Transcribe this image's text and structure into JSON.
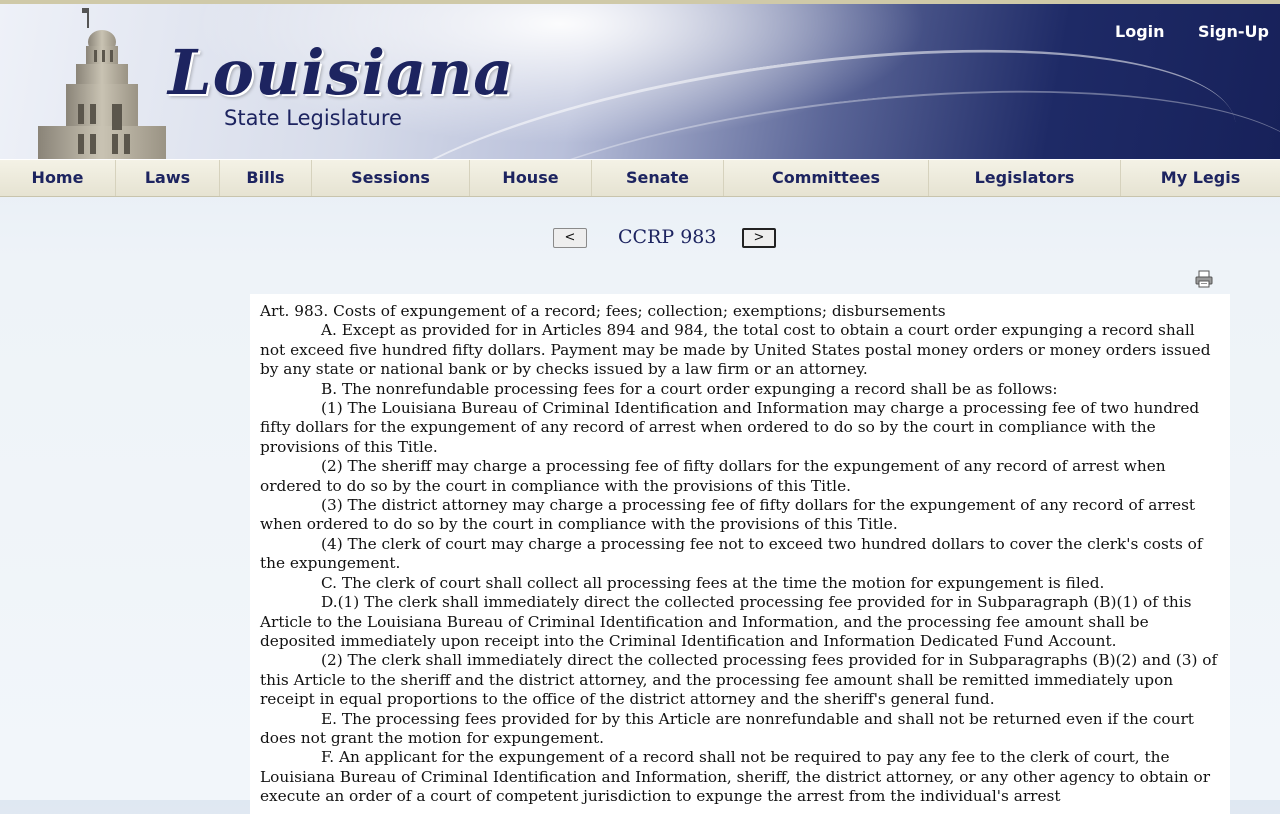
{
  "header": {
    "logo_script": "Louisiana",
    "logo_sub": "State Legislature",
    "login": "Login",
    "signup": "Sign-Up"
  },
  "nav": {
    "items": [
      "Home",
      "Laws",
      "Bills",
      "Sessions",
      "House",
      "Senate",
      "Committees",
      "Legislators",
      "My Legis"
    ]
  },
  "doc_nav": {
    "prev": "<",
    "title": "CCRP 983",
    "next": ">"
  },
  "icons": {
    "print": "print-icon"
  },
  "content": {
    "paragraphs": [
      "Art. 983. Costs of expungement of a record; fees; collection; exemptions; disbursements",
      "A. Except as provided for in Articles 894 and 984, the total cost to obtain a court order expunging a record shall not exceed five hundred fifty dollars. Payment may be made by United States postal money orders or money orders issued by any state or national bank or by checks issued by a law firm or an attorney.",
      "B. The nonrefundable processing fees for a court order expunging a record shall be as follows:",
      "(1) The Louisiana Bureau of Criminal Identification and Information may charge a processing fee of two hundred fifty dollars for the expungement of any record of arrest when ordered to do so by the court in compliance with the provisions of this Title.",
      "(2) The sheriff may charge a processing fee of fifty dollars for the expungement of any record of arrest when ordered to do so by the court in compliance with the provisions of this Title.",
      "(3) The district attorney may charge a processing fee of fifty dollars for the expungement of any record of arrest when ordered to do so by the court in compliance with the provisions of this Title.",
      "(4) The clerk of court may charge a processing fee not to exceed two hundred dollars to cover the clerk's costs of the expungement.",
      "C. The clerk of court shall collect all processing fees at the time the motion for expungement is filed.",
      "D.(1) The clerk shall immediately direct the collected processing fee provided for in Subparagraph (B)(1) of this Article to the Louisiana Bureau of Criminal Identification and Information, and the processing fee amount shall be deposited immediately upon receipt into the Criminal Identification and Information Dedicated Fund Account.",
      "(2) The clerk shall immediately direct the collected processing fees provided for in Subparagraphs (B)(2) and (3) of this Article to the sheriff and the district attorney, and the processing fee amount shall be remitted immediately upon receipt in equal proportions to the office of the district attorney and the sheriff's general fund.",
      "E. The processing fees provided for by this Article are nonrefundable and shall not be returned even if the court does not grant the motion for expungement.",
      "F. An applicant for the expungement of a record shall not be required to pay any fee to the clerk of court, the Louisiana Bureau of Criminal Identification and Information, sheriff, the district attorney, or any other agency to obtain or execute an order of a court of competent jurisdiction to expunge the arrest from the individual's arrest"
    ]
  }
}
